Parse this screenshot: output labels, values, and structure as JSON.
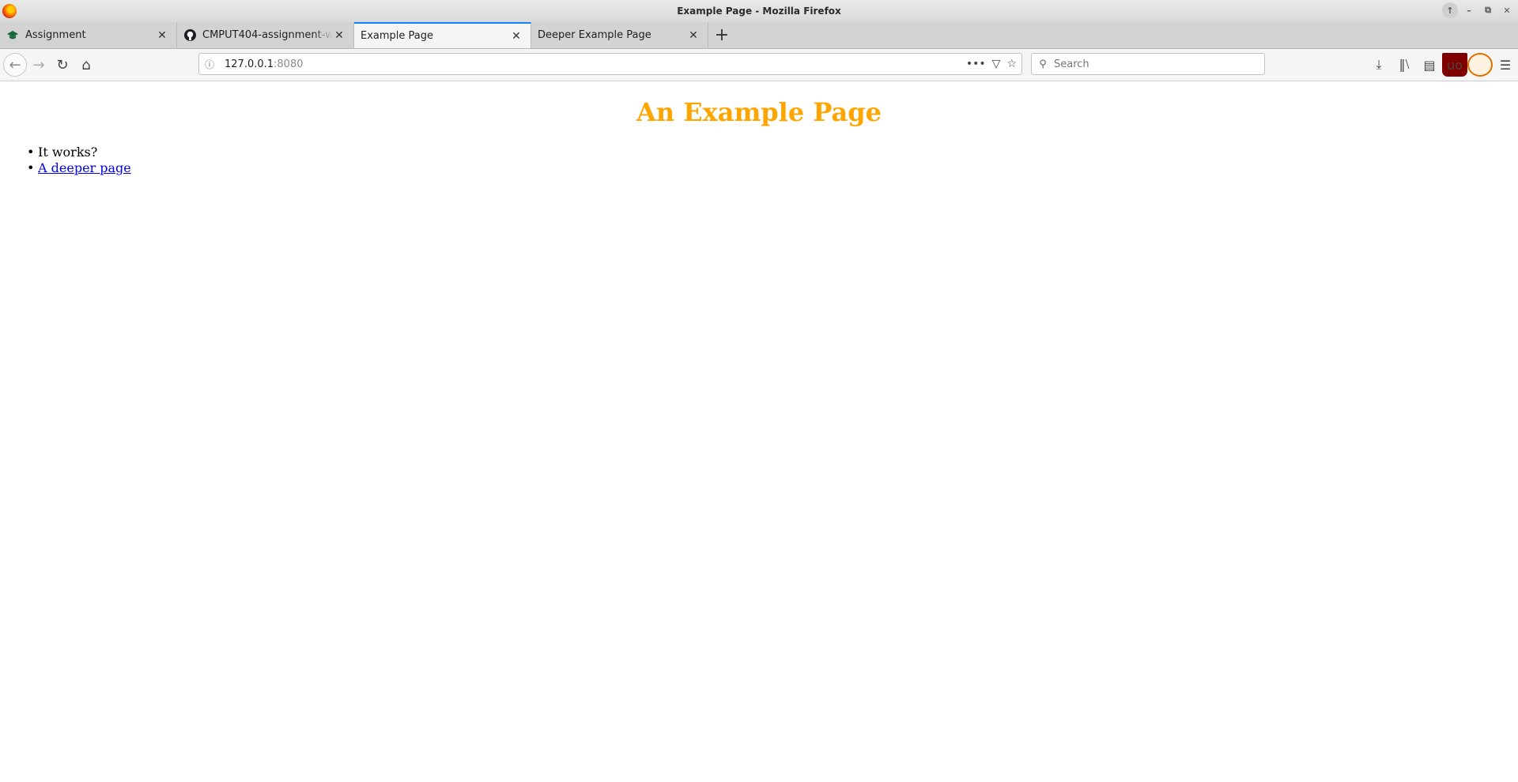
{
  "window": {
    "title": "Example Page - Mozilla Firefox"
  },
  "tabs": [
    {
      "label": "Assignment",
      "icon": "graduation-cap-icon",
      "active": false
    },
    {
      "label": "CMPUT404-assignment-w",
      "icon": "github-icon",
      "active": false
    },
    {
      "label": "Example Page",
      "icon": "",
      "active": true
    },
    {
      "label": "Deeper Example Page",
      "icon": "",
      "active": false
    }
  ],
  "navbar": {
    "url_host": "127.0.0.1",
    "url_port": ":8080",
    "search_placeholder": "Search"
  },
  "page": {
    "heading": "An Example Page",
    "heading_color": "#ffa500",
    "items": [
      {
        "text": "It works?",
        "link": false
      },
      {
        "text": "A deeper page",
        "link": true
      }
    ]
  },
  "colors": {
    "accent": "#0a84ff",
    "link": "#0000ee"
  }
}
